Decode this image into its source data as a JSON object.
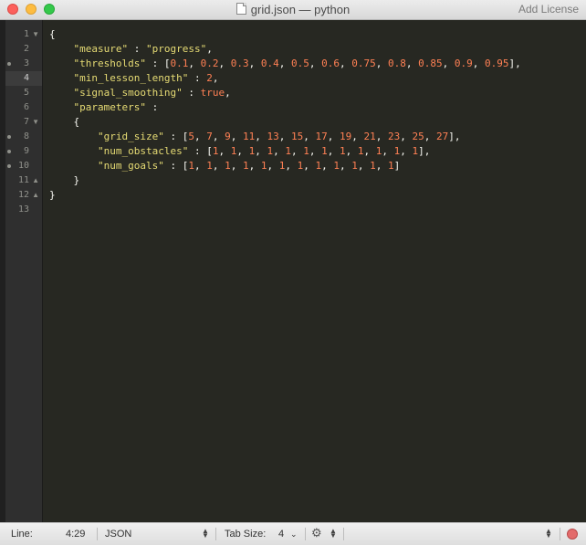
{
  "window": {
    "title": "grid.json — python",
    "license_label": "Add License"
  },
  "gutter": {
    "line_numbers": [
      "1",
      "2",
      "3",
      "4",
      "5",
      "6",
      "7",
      "8",
      "9",
      "10",
      "11",
      "12",
      "13"
    ],
    "current_line": "4"
  },
  "code": {
    "l1": "{",
    "l2_key": "\"measure\"",
    "l2_val": "\"progress\"",
    "l3_key": "\"thresholds\"",
    "l3_vals": [
      "0.1",
      "0.2",
      "0.3",
      "0.4",
      "0.5",
      "0.6",
      "0.75",
      "0.8",
      "0.85",
      "0.9",
      "0.95"
    ],
    "l4_key": "\"min_lesson_length\"",
    "l4_val": "2",
    "l5_key": "\"signal_smoothing\"",
    "l5_val": "true",
    "l6_key": "\"parameters\"",
    "l7": "{",
    "l8_key": "\"grid_size\"",
    "l8_vals": [
      "5",
      "7",
      "9",
      "11",
      "13",
      "15",
      "17",
      "19",
      "21",
      "23",
      "25",
      "27"
    ],
    "l9_key": "\"num_obstacles\"",
    "l9_vals": [
      "1",
      "1",
      "1",
      "1",
      "1",
      "1",
      "1",
      "1",
      "1",
      "1",
      "1",
      "1"
    ],
    "l10_key": "\"num_goals\"",
    "l10_vals": [
      "1",
      "1",
      "1",
      "1",
      "1",
      "1",
      "1",
      "1",
      "1",
      "1",
      "1",
      "1"
    ],
    "l11": "}",
    "l12": "}"
  },
  "statusbar": {
    "line_label": "Line:",
    "position": "4:29",
    "syntax": "JSON",
    "tab_size_label": "Tab Size:",
    "tab_size": "4"
  },
  "colors": {
    "string": "#e6db74",
    "number": "#ff8054",
    "background": "#272822"
  }
}
